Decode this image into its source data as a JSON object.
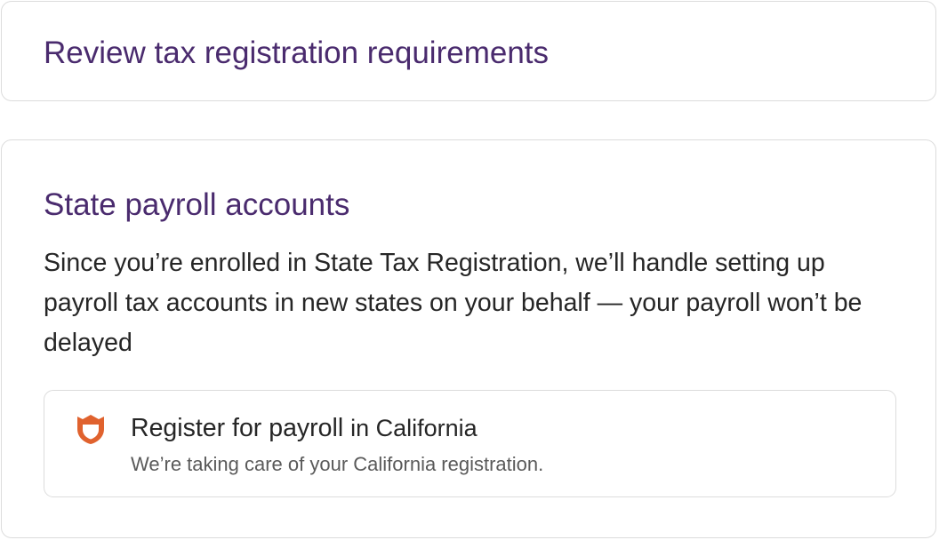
{
  "review_card": {
    "title": "Review tax registration requirements"
  },
  "state_payroll": {
    "title": "State payroll accounts",
    "description": "Since you’re enrolled in State Tax Registration, we’ll handle setting up payroll tax accounts in new states on your behalf — your payroll won’t be delayed",
    "task": {
      "icon": "shield-badge-icon",
      "icon_color": "#e0622e",
      "title": "Register for payroll",
      "state_text": "in California",
      "subtitle": "We’re taking care of your California registration."
    }
  },
  "colors": {
    "heading": "#4a2b6e",
    "body_text": "#262626",
    "muted_text": "#5a5a5a",
    "border": "#dcdcdc"
  }
}
